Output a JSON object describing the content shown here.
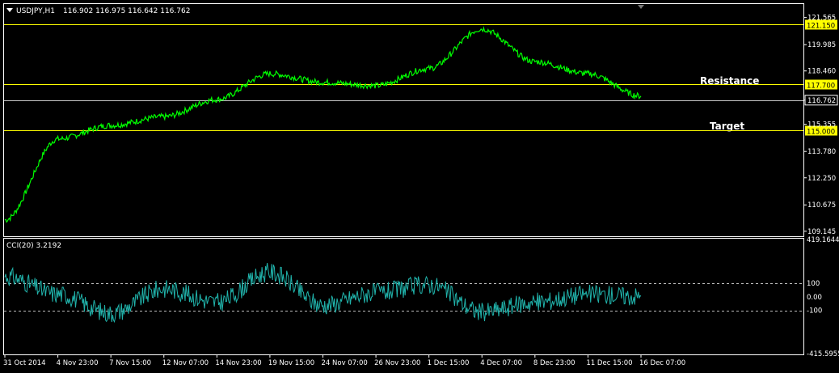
{
  "header": {
    "symbol": "USDJPY,H1",
    "ohlc": "116.902 116.975 116.642 116.762"
  },
  "colors": {
    "background": "#000000",
    "price_line": "#00ff00",
    "cci_line": "#20b2aa",
    "horizontal_levels": "#ffff00",
    "axis": "#ffffff",
    "label_highlight_bg": "#ffff00",
    "label_highlight_text": "#000000"
  },
  "annotations": {
    "resistance": "Resistance",
    "target": "Target"
  },
  "chart_data": [
    {
      "type": "line",
      "title": "USDJPY,H1",
      "series": [
        {
          "name": "USDJPY,H1",
          "x": [
            "31 Oct 2014",
            "4 Nov 23:00",
            "7 Nov 15:00",
            "12 Nov 07:00",
            "14 Nov 23:00",
            "19 Nov 15:00",
            "24 Nov 07:00",
            "26 Nov 23:00",
            "1 Dec 15:00",
            "4 Dec 07:00",
            "8 Dec 23:00",
            "11 Dec 15:00",
            "16 Dec 07:00"
          ],
          "values": [
            109.8,
            114.5,
            115.3,
            115.8,
            116.8,
            118.3,
            117.8,
            117.6,
            118.6,
            120.9,
            119.0,
            118.3,
            117.0
          ]
        }
      ],
      "last_value": 116.762,
      "ylim": [
        108.9,
        122.3
      ],
      "y_ticks": [
        "121.565",
        "119.985",
        "118.460",
        "116.762",
        "115.355",
        "113.780",
        "112.250",
        "110.675",
        "109.145"
      ],
      "horizontal_levels": [
        {
          "value": 121.15,
          "label": "121.150"
        },
        {
          "value": 117.7,
          "label": "117.700",
          "annotation": "Resistance"
        },
        {
          "value": 115.0,
          "label": "115.000",
          "annotation": "Target"
        }
      ],
      "grid": false
    },
    {
      "type": "line",
      "title": "CCI(20) 3.2192",
      "series": [
        {
          "name": "CCI(20)",
          "x": [
            "31 Oct 2014",
            "4 Nov 23:00",
            "7 Nov 15:00",
            "12 Nov 07:00",
            "14 Nov 23:00",
            "19 Nov 15:00",
            "24 Nov 07:00",
            "26 Nov 23:00",
            "1 Dec 15:00",
            "4 Dec 07:00",
            "8 Dec 23:00",
            "11 Dec 15:00",
            "16 Dec 07:00"
          ],
          "values": [
            150,
            20,
            -120,
            60,
            -40,
            180,
            -60,
            30,
            90,
            -110,
            -40,
            20,
            3.2192
          ]
        }
      ],
      "ylim": [
        -415.5955,
        419.1644
      ],
      "y_ticks": [
        "419.1644",
        "100",
        "0.00",
        "-100",
        "-415.5955"
      ],
      "levels": [
        100,
        -100
      ]
    }
  ],
  "x_axis": {
    "labels": [
      "31 Oct 2014",
      "4 Nov 23:00",
      "7 Nov 15:00",
      "12 Nov 07:00",
      "14 Nov 23:00",
      "19 Nov 15:00",
      "24 Nov 07:00",
      "26 Nov 23:00",
      "1 Dec 15:00",
      "4 Dec 07:00",
      "8 Dec 23:00",
      "11 Dec 15:00",
      "16 Dec 07:00"
    ]
  }
}
